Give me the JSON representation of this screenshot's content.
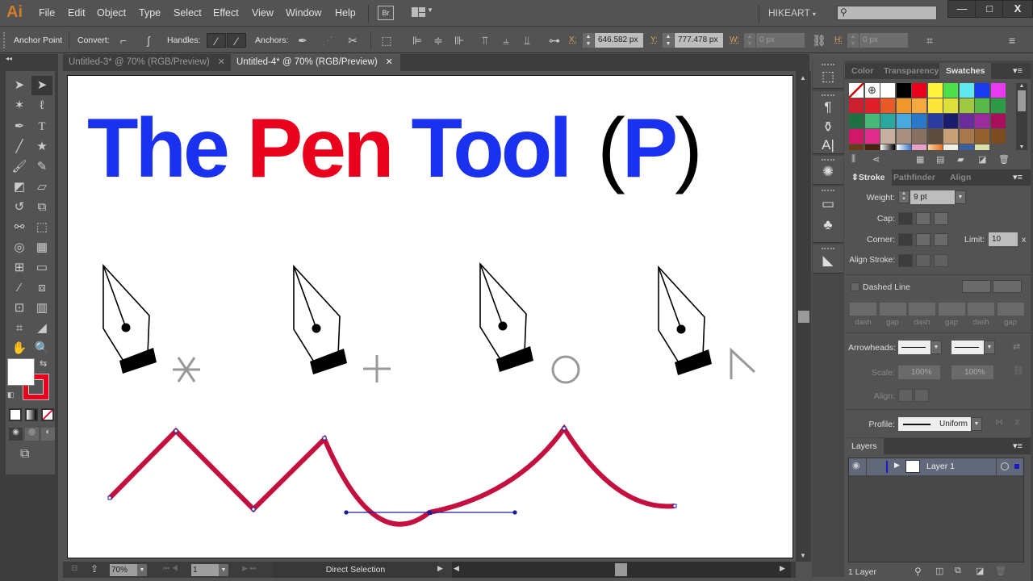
{
  "app": {
    "logo": "Ai"
  },
  "menu": [
    "File",
    "Edit",
    "Object",
    "Type",
    "Select",
    "Effect",
    "View",
    "Window",
    "Help"
  ],
  "menubar": {
    "bridge_label": "Br",
    "workspace": "HIKEART",
    "search_placeholder": ""
  },
  "window_controls": {
    "minimize": "—",
    "maximize": "□",
    "close": "X"
  },
  "controlbar": {
    "context": "Anchor Point",
    "convert_label": "Convert:",
    "handles_label": "Handles:",
    "anchors_label": "Anchors:",
    "x_label": "X:",
    "x_value": "646.582 px",
    "y_label": "Y:",
    "y_value": "777.478 px",
    "w_label": "W:",
    "w_value": "0 px",
    "h_label": "H:",
    "h_value": "0 px"
  },
  "tabs": [
    {
      "label": "Untitled-3* @ 70% (RGB/Preview)",
      "active": false
    },
    {
      "label": "Untitled-4* @ 70% (RGB/Preview)",
      "active": true
    }
  ],
  "artboard": {
    "title_parts": [
      {
        "text": "The",
        "color": "#1a32f0"
      },
      {
        "text": "Pen",
        "color": "#e8001c"
      },
      {
        "text": "Tool",
        "color": "#1a32f0"
      },
      {
        "text": "(",
        "color": "#000000"
      },
      {
        "text": "P",
        "color": "#1a32f0"
      },
      {
        "text": ")",
        "color": "#000000"
      }
    ],
    "cursors": [
      {
        "name": "pen-start",
        "modifier": "asterisk"
      },
      {
        "name": "pen-add",
        "modifier": "plus"
      },
      {
        "name": "pen-close",
        "modifier": "circle"
      },
      {
        "name": "pen-convert",
        "modifier": "caret"
      }
    ],
    "path_stroke_color": "#c4103f",
    "anchor_color": "#1a1a9c"
  },
  "statusbar": {
    "zoom": "70%",
    "artboard_number": "1",
    "tool": "Direct Selection"
  },
  "right_panels": {
    "swatch_tabs": [
      "Color",
      "Transparency",
      "Swatches"
    ],
    "swatches": [
      [
        "none",
        "registration",
        "#ffffff",
        "#000000",
        "#e8001c",
        "#fff23a",
        "#4be04a",
        "#5fe8f0",
        "#1a3af0",
        "#e83af0"
      ],
      [
        "#cc2030",
        "#e01e2a",
        "#e85a28",
        "#f0962a",
        "#f4aa40",
        "#fce43a",
        "#dde03a",
        "#a0c840",
        "#58b848",
        "#2e9a48"
      ],
      [
        "#1e7040",
        "#48b878",
        "#2aa8a0",
        "#48a8e0",
        "#2a78c8",
        "#2a3ca0",
        "#1c1c6c",
        "#6a2c9c",
        "#9a2c9c",
        "#a8105c"
      ],
      [
        "#d01868",
        "#e02c8a",
        "#c8b0a0",
        "#a89080",
        "#887060",
        "#5c4c40",
        "#c8a078",
        "#a8784c",
        "#946030",
        "#7c4c20"
      ]
    ],
    "stroke_tabs": [
      "Stroke",
      "Pathfinder",
      "Align"
    ],
    "stroke": {
      "weight_label": "Weight:",
      "weight_value": "9 pt",
      "cap_label": "Cap:",
      "corner_label": "Corner:",
      "limit_label": "Limit:",
      "limit_value": "10",
      "limit_unit": "x",
      "align_label": "Align Stroke:",
      "dashed_label": "Dashed Line",
      "dash_labels": [
        "dash",
        "gap",
        "dash",
        "gap",
        "dash",
        "gap"
      ],
      "arrowheads_label": "Arrowheads:",
      "scale_label": "Scale:",
      "scale_start": "100%",
      "scale_end": "100%",
      "align2_label": "Align:",
      "profile_label": "Profile:",
      "profile_value": "Uniform"
    },
    "layers_tab": "Layers",
    "layers": [
      {
        "name": "Layer 1",
        "color": "#1a1ac8"
      }
    ],
    "layers_count": "1 Layer"
  }
}
